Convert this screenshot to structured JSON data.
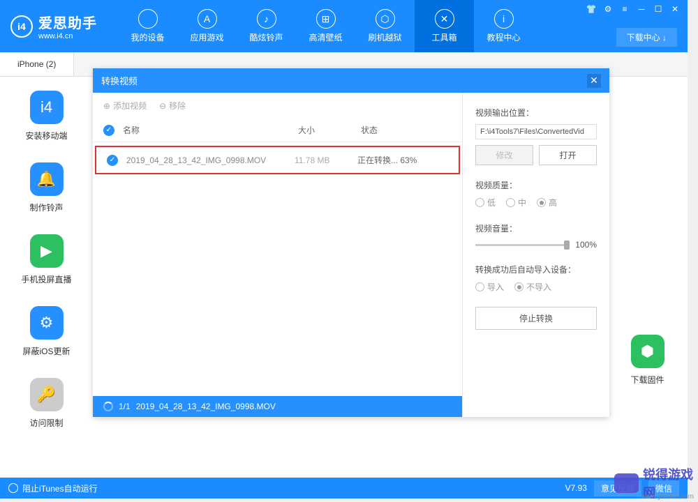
{
  "app": {
    "title": "爱思助手",
    "url": "www.i4.cn"
  },
  "nav": [
    {
      "label": "我的设备",
      "icon": ""
    },
    {
      "label": "应用游戏",
      "icon": "A"
    },
    {
      "label": "酷炫铃声",
      "icon": "♪"
    },
    {
      "label": "高清壁纸",
      "icon": "⊞"
    },
    {
      "label": "刷机越狱",
      "icon": "⬡"
    },
    {
      "label": "工具箱",
      "icon": "✕"
    },
    {
      "label": "教程中心",
      "icon": "i"
    }
  ],
  "download_center": "下载中心 ↓",
  "tab": "iPhone (2)",
  "tools": [
    {
      "label": "安装移动端",
      "color": "#2690ff",
      "icon": "i4"
    },
    {
      "label": "制作铃声",
      "color": "#2690ff",
      "icon": "🔔"
    },
    {
      "label": "手机投屏直播",
      "color": "#2cc060",
      "icon": "▶"
    },
    {
      "label": "屏蔽iOS更新",
      "color": "#2690ff",
      "icon": "⚙"
    },
    {
      "label": "访问限制",
      "color": "#cccccc",
      "icon": "🔑"
    }
  ],
  "right_tool": {
    "label": "下载固件",
    "color": "#2cc060",
    "icon": "⬡"
  },
  "dialog": {
    "title": "转换视频",
    "toolbar": {
      "add": "添加视频",
      "remove": "移除"
    },
    "columns": {
      "name": "名称",
      "size": "大小",
      "status": "状态"
    },
    "row": {
      "name": "2019_04_28_13_42_IMG_0998.MOV",
      "size": "11.78 MB",
      "status": "正在转换... 63%"
    },
    "progress": {
      "count": "1/1",
      "file": "2019_04_28_13_42_IMG_0998.MOV"
    },
    "side": {
      "output_label": "视频输出位置：",
      "output_path": "F:\\i4Tools7\\Files\\ConvertedVid",
      "modify": "修改",
      "open": "打开",
      "quality_label": "视频质量：",
      "q_low": "低",
      "q_mid": "中",
      "q_high": "高",
      "volume_label": "视频音量：",
      "volume_value": "100%",
      "import_label": "转换成功后自动导入设备：",
      "import_yes": "导入",
      "import_no": "不导入",
      "stop": "停止转换"
    }
  },
  "bottom": {
    "itunes": "阻止iTunes自动运行",
    "version": "V7.93",
    "feedback": "意见反馈",
    "wechat": "微信"
  },
  "watermark": {
    "brand": "锐得游戏网",
    "url": "www.ytruida.com"
  }
}
